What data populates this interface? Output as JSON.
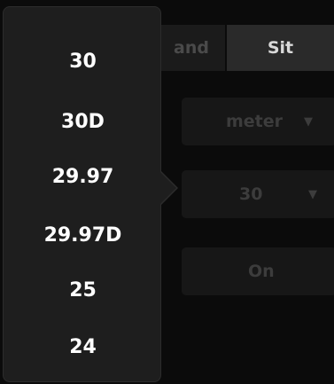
{
  "tabs": [
    {
      "label": "and"
    },
    {
      "label": "Sit"
    }
  ],
  "controls": [
    {
      "value": "meter",
      "icon": "dropdown-arrow-icon"
    },
    {
      "value": "30",
      "icon": "dropdown-arrow-icon"
    },
    {
      "value": "On"
    }
  ],
  "popup": {
    "options": [
      {
        "label": "30"
      },
      {
        "label": "30D"
      },
      {
        "label": "29.97"
      },
      {
        "label": "29.97D"
      },
      {
        "label": "25"
      },
      {
        "label": "24"
      }
    ]
  },
  "colors": {
    "background": "#0b0b0b",
    "popup_bg": "#1e1e1e",
    "active_tab": "#2a2a2a",
    "option_text": "#ffffff"
  }
}
